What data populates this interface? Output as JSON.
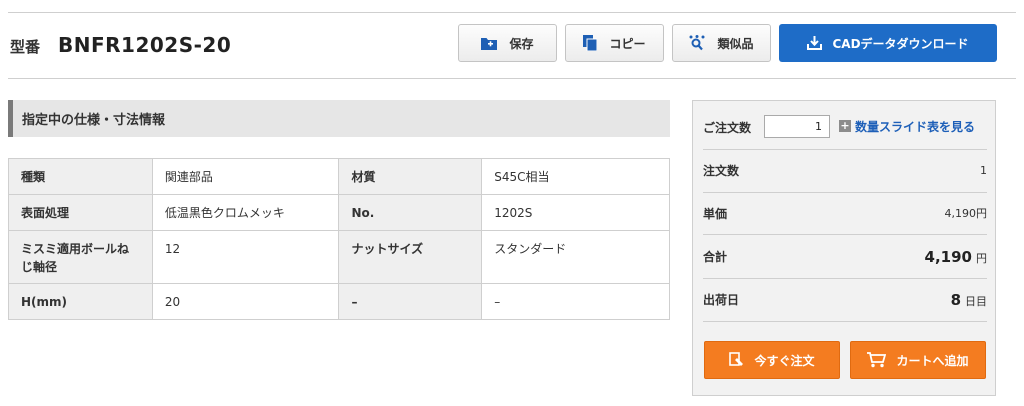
{
  "header": {
    "model_label": "型番",
    "model_number": "BNFR1202S-20"
  },
  "actions": {
    "save_label": "保存",
    "copy_label": "コピー",
    "similar_label": "類似品",
    "cad_label": "CADデータダウンロード"
  },
  "spec": {
    "title": "指定中の仕様・寸法情報",
    "rows": [
      {
        "k1": "種類",
        "v1": "関連部品",
        "k2": "材質",
        "v2": "S45C相当"
      },
      {
        "k1": "表面処理",
        "v1": "低温黒色クロムメッキ",
        "k2": "No.",
        "v2": "1202S"
      },
      {
        "k1": "ミスミ適用ボールねじ軸径",
        "v1": "12",
        "k2": "ナットサイズ",
        "v2": "スタンダード"
      },
      {
        "k1": "H(mm)",
        "v1": "20",
        "k2": "–",
        "v2": "–"
      }
    ]
  },
  "order": {
    "qty_label": "ご注文数",
    "qty_value": "1",
    "slide_link": "数量スライド表を見る",
    "count_label": "注文数",
    "count_value": "1",
    "unit_price_label": "単価",
    "unit_price_value": "4,190円",
    "total_label": "合計",
    "total_value": "4,190",
    "total_unit": "円",
    "ship_label": "出荷日",
    "ship_value": "8",
    "ship_unit": "日目",
    "order_now_label": "今すぐ注文",
    "cart_label": "カートへ追加"
  },
  "colors": {
    "accent_blue": "#1e6cc7",
    "accent_orange": "#f47c20",
    "link_blue": "#1d5fb8"
  }
}
